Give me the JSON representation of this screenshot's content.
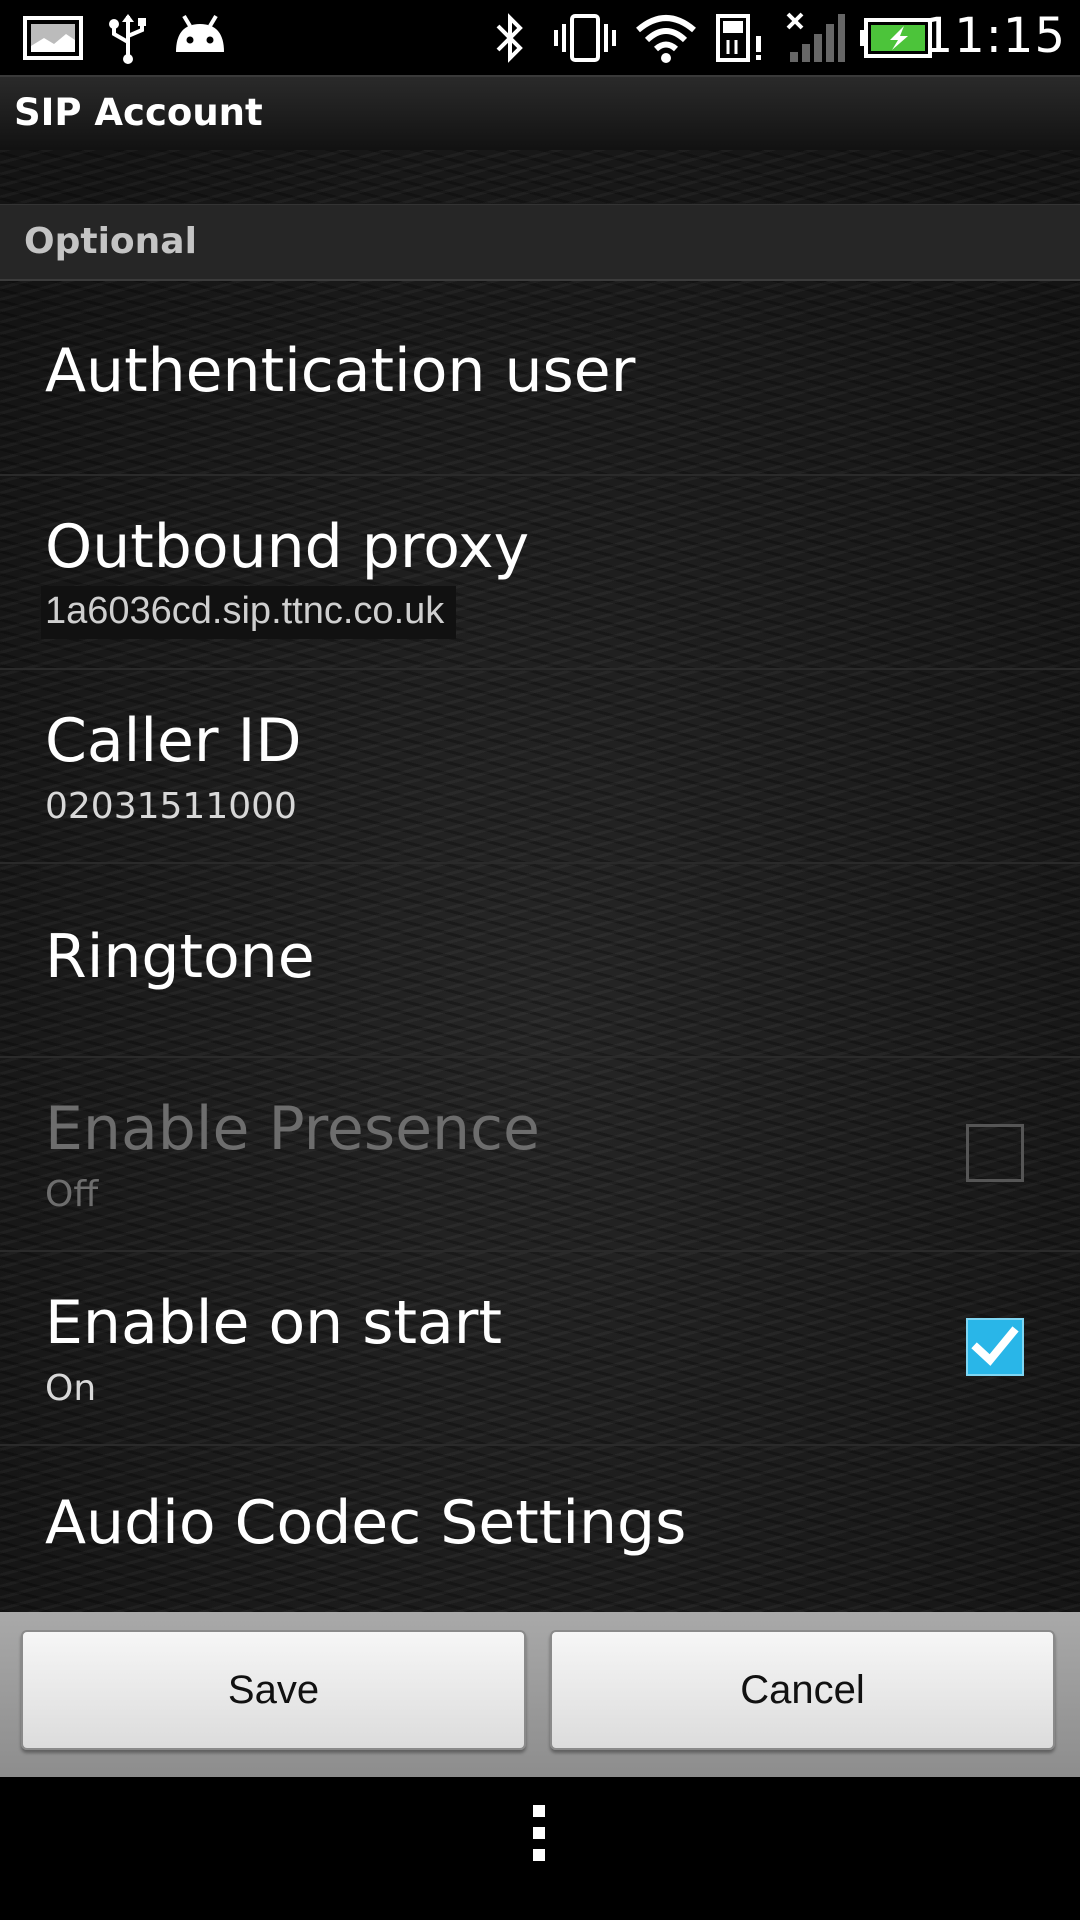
{
  "status_bar": {
    "time": "11:15",
    "left_icons": [
      "gallery-notification-icon",
      "usb-icon",
      "android-debug-icon"
    ],
    "right_icons": [
      "bluetooth-icon",
      "vibrate-icon",
      "wifi-icon",
      "sd-card-alert-icon",
      "no-signal-icon",
      "battery-charging-icon"
    ],
    "battery_color": "#4cc43a"
  },
  "title_bar": {
    "title": "SIP Account"
  },
  "content": {
    "clipped_previous_value": "**************",
    "section_header": "Optional",
    "preferences": [
      {
        "title": "Authentication user",
        "summary": ""
      },
      {
        "title": "Outbound proxy",
        "summary": "1a6036cd.sip.ttnc.co.uk"
      },
      {
        "title": "Caller ID",
        "summary": "02031511000"
      },
      {
        "title": "Ringtone",
        "summary": ""
      },
      {
        "title": "Enable Presence",
        "summary": "Off",
        "checked": false,
        "enabled": false
      },
      {
        "title": "Enable on start",
        "summary": "On",
        "checked": true,
        "enabled": true
      },
      {
        "title": "Audio Codec Settings",
        "summary": ""
      }
    ]
  },
  "buttons": {
    "save_label": "Save",
    "cancel_label": "Cancel"
  },
  "nav_bar": {
    "menu_icon": "overflow-menu-icon"
  },
  "colors": {
    "accent": "#29b6e8",
    "background": "#1b1b1b",
    "button_bar": "#9b9b9b"
  }
}
